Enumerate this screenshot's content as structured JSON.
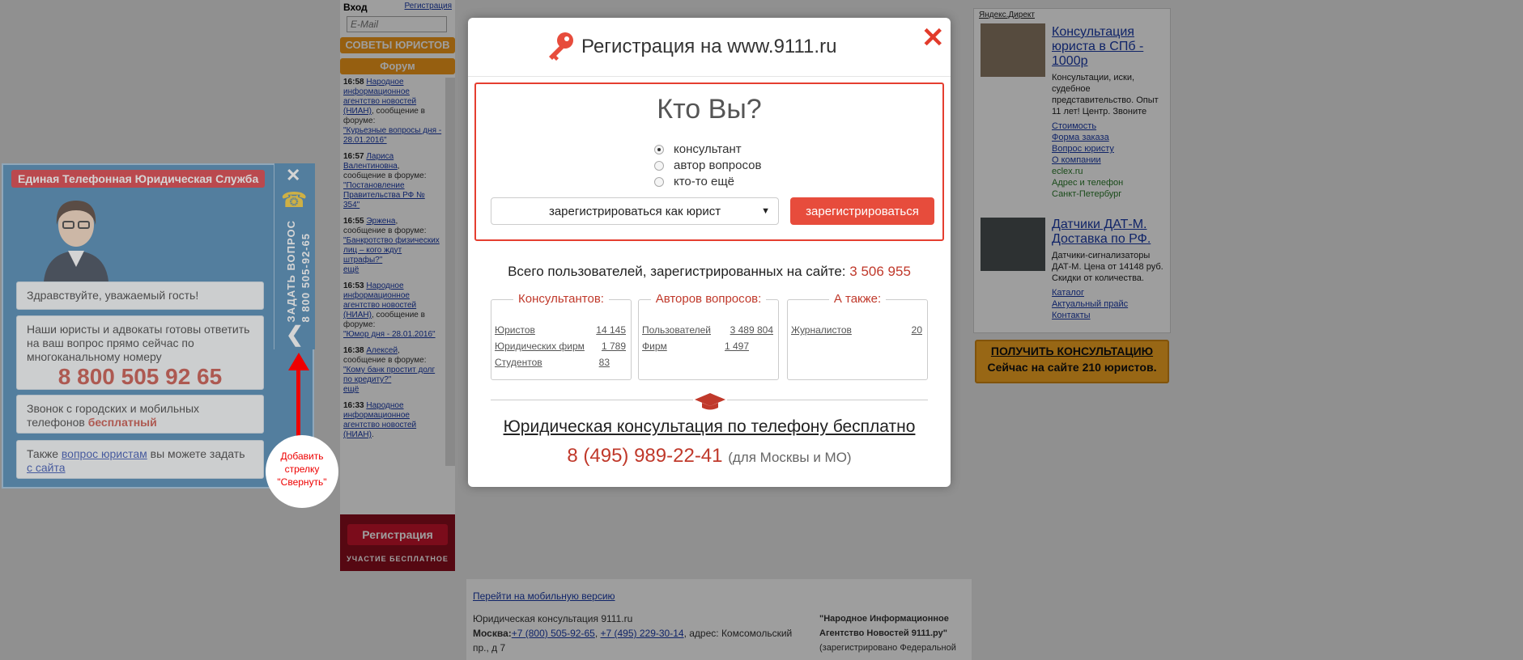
{
  "forum": {
    "login_label": "Вход",
    "register_link": "Регистрация",
    "email_placeholder": "E-Mail",
    "advice_button": "СОВЕТЫ ЮРИСТОВ",
    "forum_button": "Форум",
    "items": [
      {
        "time": "16:58",
        "author": "Народное информационное агентство новостей (НИАН)",
        "action": ", сообщение в форуме:",
        "topic": "\"Курьезные вопросы дня - 28.01.2016\""
      },
      {
        "time": "16:57",
        "author": "Лариса Валентиновна",
        "action": ", сообщение в форуме:",
        "topic": "\"Постановление Правительства РФ № 354\""
      },
      {
        "time": "16:55",
        "author": "Эржена",
        "action": ", сообщение в форуме:",
        "topic": "\"Банкротство физических лиц – кого ждут штрафы?\"",
        "more": "ещё"
      },
      {
        "time": "16:53",
        "author": "Народное информационное агентство новостей (НИАН)",
        "action": ", сообщение в форуме:",
        "topic": "\"Юмор дня - 28.01.2016\""
      },
      {
        "time": "16:38",
        "author": "Алексей",
        "action": ", сообщение в форуме:",
        "topic": "\"Кому банк простит долг по кредиту?\"",
        "more": "ещё"
      },
      {
        "time": "16:33",
        "author": "Народное информационное агентство новостей (НИАН)",
        "action": ".",
        "topic": ""
      }
    ],
    "reg_button": "Регистрация",
    "reg_note": "УЧАСТИЕ БЕСПЛАТНОЕ"
  },
  "widget": {
    "title": "Единая Телефонная Юридическая Служба",
    "greeting": "Здравствуйте, уважаемый гость!",
    "ready_text": "Наши юристы и адвокаты готовы ответить на ваш вопрос прямо сейчас по многоканальному номеру",
    "phone": "8 800 505 92 65",
    "call_text": "Звонок с городских и мобильных телефонов",
    "call_free": "бесплатный",
    "also_prefix": "Также",
    "also_link": "вопрос юристам",
    "also_mid": "вы можете задать",
    "also_link2": "с сайта",
    "tab_line1": "ЗАДАТЬ ВОПРОС",
    "tab_line2": "8 800 505-92-65"
  },
  "annotation": {
    "text": "Добавить стрелку \"Свернуть\""
  },
  "ads": {
    "label": "Яндекс.Директ",
    "ad1": {
      "title": "Консультация юриста в СПб - 1000р",
      "text": "Консультации, иски, судебное представительство. Опыт 11 лет! Центр. Звоните",
      "links": [
        "Стоимость",
        "Форма заказа",
        "Вопрос юристу",
        "О компании"
      ],
      "domain": "eclex.ru",
      "extra": "Адрес и телефон",
      "city": "Санкт-Петербург"
    },
    "ad2": {
      "title": "Датчики ДАТ-М. Доставка по РФ.",
      "text": "Датчики-сигнализаторы ДАТ-М. Цена от 14148 руб. Скидки от количества.",
      "links": [
        "Каталог",
        "Актуальный прайс",
        "Контакты"
      ]
    },
    "cons_button": "ПОЛУЧИТЬ КОНСУЛЬТАЦИЮ",
    "cons_sub": "Сейчас на сайте 210 юристов."
  },
  "footer": {
    "mobile_link": "Перейти на мобильную версию",
    "site_name": "Юридическая консультация 9111.ru",
    "moscow_label": "Москва:",
    "phone1": "+7 (800) 505-92-65",
    "phone2": "+7 (495) 229-30-14",
    "address": ", адрес: Комсомольский пр., д 7",
    "agency": "\"Народное Информационное Агентство Новостей 9111.ру\"",
    "agency_note": "(зарегистрировано Федеральной"
  },
  "modal": {
    "title": "Регистрация на www.9111.ru",
    "who_title": "Кто Вы?",
    "roles": [
      {
        "label": "консультант",
        "checked": true
      },
      {
        "label": "автор вопросов",
        "checked": false
      },
      {
        "label": "кто-то ещё",
        "checked": false
      }
    ],
    "role_select_value": "зарегистрироваться как юрист",
    "submit_label": "зарегистрироваться",
    "total_prefix": "Всего пользователей, зарегистрированных на сайте:",
    "total_value": "3 506 955",
    "consultants": {
      "title": "Консультантов:",
      "rows": [
        {
          "label": "Юристов",
          "value": "14 145"
        },
        {
          "label": "Юридических фирм",
          "value": "1 789"
        },
        {
          "label": "Студентов",
          "value": "83"
        }
      ]
    },
    "authors": {
      "title": "Авторов вопросов:",
      "rows": [
        {
          "label": "Пользователей",
          "value": "3 489 804"
        },
        {
          "label": "Фирм",
          "value": "1 497"
        }
      ]
    },
    "also": {
      "title": "А также:",
      "rows": [
        {
          "label": "Журналистов",
          "value": "20"
        }
      ]
    },
    "consult_text": "Юридическая консультация по телефону бесплатно",
    "phone": "8 (495) 989-22-41",
    "phone_note": "(для Москвы и МО)"
  },
  "colors": {
    "accent": "#e74c3c",
    "widget_blue": "#2f74a8",
    "orange": "#f29a1a"
  }
}
